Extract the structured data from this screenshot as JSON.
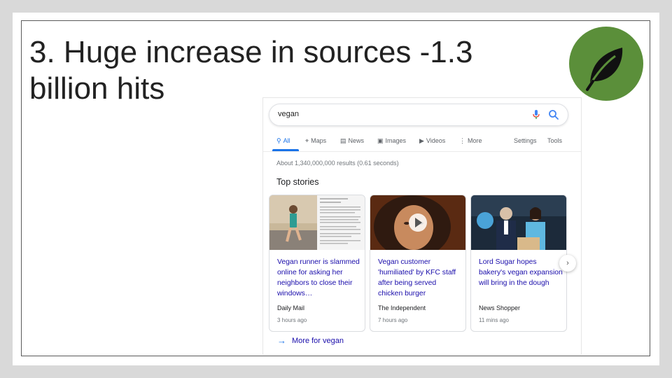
{
  "slide": {
    "title_line1": "3. Huge increase in sources -1.3",
    "title_line2": "billion hits",
    "badge_icon": "leaf-icon",
    "badge_color": "#5b8f3a"
  },
  "search": {
    "query": "vegan",
    "mic_icon": "mic-icon",
    "search_icon": "search-icon"
  },
  "tabs": [
    {
      "label": "All",
      "icon": "search-icon",
      "active": true
    },
    {
      "label": "Maps",
      "icon": "map-pin-icon",
      "active": false
    },
    {
      "label": "News",
      "icon": "news-icon",
      "active": false
    },
    {
      "label": "Images",
      "icon": "image-icon",
      "active": false
    },
    {
      "label": "Videos",
      "icon": "video-icon",
      "active": false
    },
    {
      "label": "More",
      "icon": "more-vertical-icon",
      "active": false
    },
    {
      "label": "Settings",
      "active": false
    },
    {
      "label": "Tools",
      "active": false
    }
  ],
  "results_count": "About 1,340,000,000 results (0.61 seconds)",
  "top_stories": {
    "heading": "Top stories",
    "cards": [
      {
        "headline": "Vegan runner is slammed online for asking her neighbors to close their windows…",
        "source": "Daily Mail",
        "time": "3 hours ago"
      },
      {
        "headline": "Vegan customer 'humiliated' by KFC staff after being served chicken burger",
        "source": "The Independent",
        "time": "7 hours ago"
      },
      {
        "headline": "Lord Sugar hopes bakery's vegan expansion will bring in the dough",
        "source": "News Shopper",
        "time": "11 mins ago"
      }
    ],
    "next_icon": "chevron-right-icon"
  },
  "more_link": "More for vegan",
  "colors": {
    "link": "#1a0dab",
    "accent": "#1a73e8"
  }
}
